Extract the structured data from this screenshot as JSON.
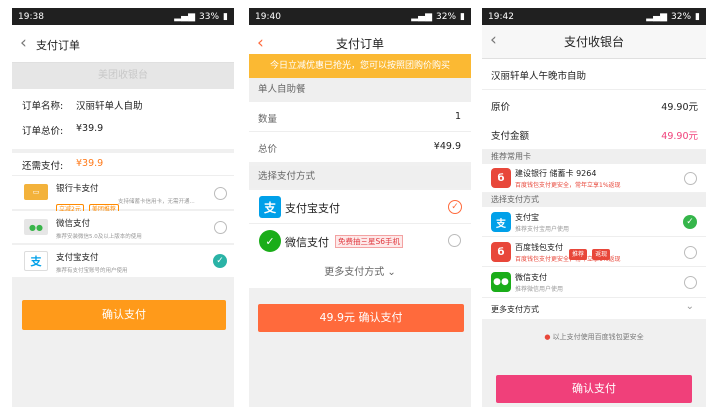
{
  "p1": {
    "time": "19:38",
    "battery": "33%",
    "title": "支付订单",
    "banner": "美团收银台",
    "order_name_label": "订单名称:",
    "order_name": "汉丽轩单人自助",
    "order_total_label": "订单总价:",
    "order_total": "¥39.9",
    "remaining_label": "还需支付:",
    "remaining": "¥39.9",
    "methods": [
      {
        "name": "银行卡支付",
        "desc": "支持储蓄卡信用卡，无需开通...",
        "tags": [
          "立减2元",
          "美团推荐"
        ],
        "selected": false
      },
      {
        "name": "微信支付",
        "desc": "推荐安装微信5.0及以上版本的使用",
        "selected": false
      },
      {
        "name": "支付宝支付",
        "desc": "推荐有支付宝账号的用户使用",
        "selected": true
      }
    ],
    "confirm": "确认支付",
    "accent": "#ff9a1a"
  },
  "p2": {
    "time": "19:40",
    "battery": "32%",
    "title": "支付订单",
    "promo": "今日立减优惠已抢光，您可以按照团购价购买",
    "section": "单人自助餐",
    "qty_label": "数量",
    "qty": "1",
    "total_label": "总价",
    "total": "¥49.9",
    "choose_label": "选择支付方式",
    "methods": [
      {
        "name": "支付宝支付",
        "selected": true
      },
      {
        "name": "微信支付",
        "badge": "免费抽三星S6手机",
        "selected": false
      }
    ],
    "more": "更多支付方式",
    "confirm": "49.9元 确认支付",
    "accent": "#ff6a3c"
  },
  "p3": {
    "time": "19:42",
    "battery": "32%",
    "title": "支付收银台",
    "merchant": "汉丽轩单人午晚市自助",
    "orig_label": "原价",
    "orig": "49.90元",
    "pay_label": "支付金额",
    "pay": "49.90元",
    "fav_label": "推荐常用卡",
    "card": {
      "name": "建设银行 储蓄卡 9264",
      "desc": "百度钱包支付更安全，常年立享1%返现"
    },
    "choose_label": "选择支付方式",
    "methods": [
      {
        "name": "支付宝",
        "desc": "推荐支付宝用户使用",
        "selected": true
      },
      {
        "name": "百度钱包支付",
        "badges": [
          "推荐",
          "返现"
        ],
        "desc": "百度钱包支付更安全，常年立享1%返现",
        "selected": false
      },
      {
        "name": "微信支付",
        "desc": "推荐微信用户使用",
        "selected": false
      }
    ],
    "more": "更多支付方式",
    "secure": "以上支付使用百度钱包更安全",
    "confirm": "确认支付",
    "accent": "#f0407a"
  }
}
